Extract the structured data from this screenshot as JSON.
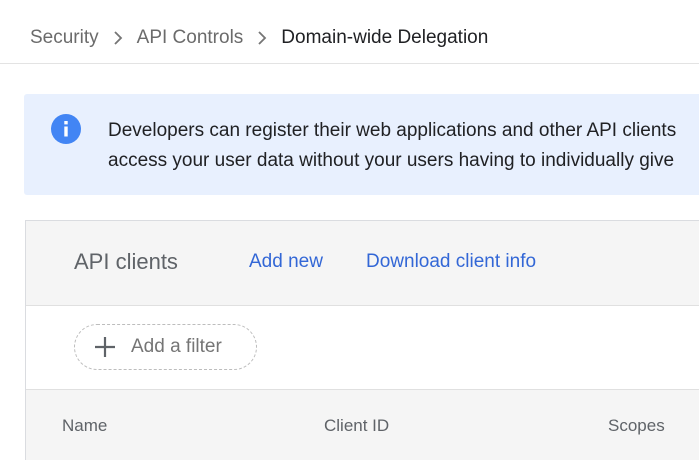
{
  "breadcrumb": {
    "items": [
      "Security",
      "API Controls"
    ],
    "current": "Domain-wide Delegation"
  },
  "info_banner": {
    "icon": "info-icon",
    "line1": "Developers can register their web applications and other API clients",
    "line2": "access your user data without your users having to individually give"
  },
  "api_clients": {
    "title": "API clients",
    "add_new_label": "Add new",
    "download_label": "Download client info",
    "filter_label": "Add a filter",
    "columns": [
      "Name",
      "Client ID",
      "Scopes"
    ]
  },
  "colors": {
    "banner_bg": "#e8f0fe",
    "info_icon": "#4285f4",
    "link": "#3367d6"
  }
}
